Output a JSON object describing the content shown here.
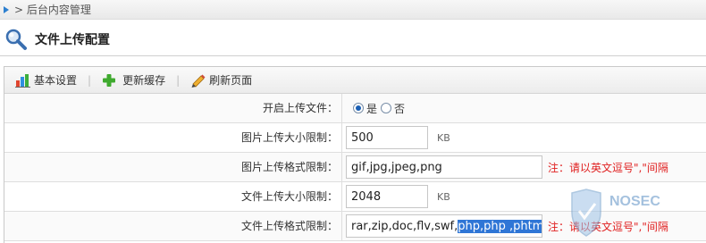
{
  "breadcrumb": {
    "text": "> 后台内容管理"
  },
  "page": {
    "title": "文件上传配置"
  },
  "toolbar": {
    "items": [
      {
        "label": "基本设置",
        "icon": "bar-chart-icon"
      },
      {
        "label": "更新缓存",
        "icon": "plus-icon"
      },
      {
        "label": "刷新页面",
        "icon": "pencil-icon"
      }
    ]
  },
  "form": {
    "enable_upload": {
      "label": "开启上传文件：",
      "options": [
        "是",
        "否"
      ],
      "selected": "是"
    },
    "image_max_size": {
      "label": "图片上传大小限制：",
      "value": "500",
      "unit": "KB"
    },
    "image_formats": {
      "label": "图片上传格式限制：",
      "value": "gif,jpg,jpeg,png",
      "note": "注：请以英文逗号\",\"间隔"
    },
    "file_max_size": {
      "label": "文件上传大小限制：",
      "value": "2048",
      "unit": "KB"
    },
    "file_formats": {
      "label": "文件上传格式限制：",
      "value_plain": "rar,zip,doc,flv,swf,",
      "value_selected": "php,php ,phtml",
      "note": "注：请以英文逗号\",\"间隔"
    }
  },
  "watermark": {
    "text": "NOSEC"
  },
  "colors": {
    "accent": "#2f76d6",
    "note": "#e02020",
    "title_icon": "#3a6fb0"
  }
}
